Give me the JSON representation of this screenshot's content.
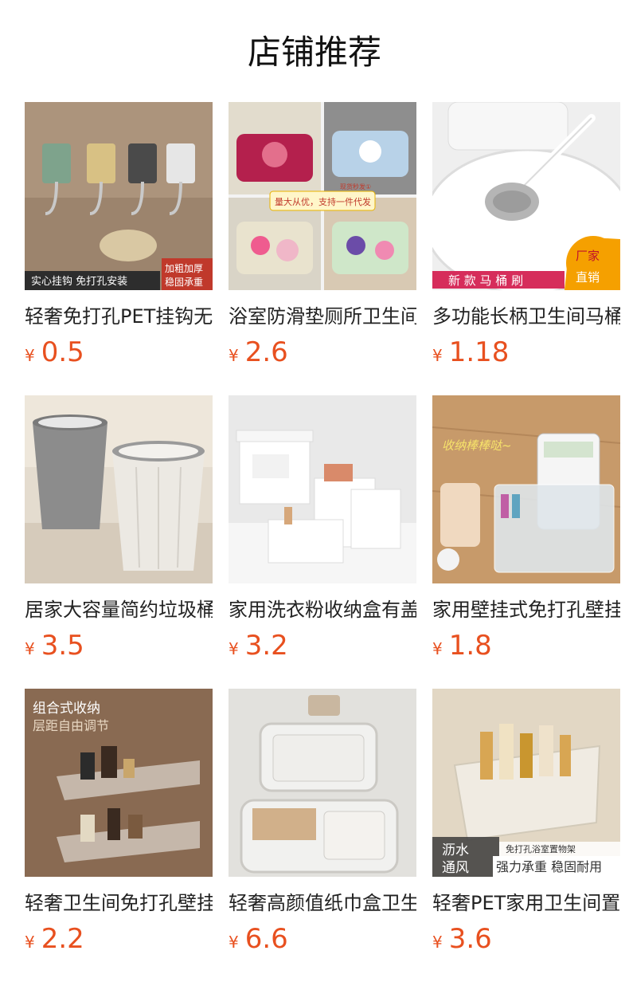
{
  "page": {
    "title": "店铺推荐"
  },
  "products": [
    {
      "name": "轻奢免打孔PET挂钩无痕强力粘胶",
      "currency": "¥",
      "price": "0.5",
      "badges": [
        "实心挂钩 免打孔安装",
        "加粗加厚",
        "稳固承重"
      ]
    },
    {
      "name": "浴室防滑垫厕所卫生间吸水地垫",
      "currency": "¥",
      "price": "2.6",
      "badges": [
        "量大从优，支持一件代发",
        "现货秒发①"
      ]
    },
    {
      "name": "多功能长柄卫生间马桶刷",
      "currency": "¥",
      "price": "1.18",
      "badges": [
        "新 款 马 桶 刷",
        "厂家",
        "直销"
      ]
    },
    {
      "name": "居家大容量简约垃圾桶",
      "currency": "¥",
      "price": "3.5",
      "badges": []
    },
    {
      "name": "家用洗衣粉收纳盒有盖",
      "currency": "¥",
      "price": "3.2",
      "badges": []
    },
    {
      "name": "家用壁挂式免打孔壁挂收纳盒",
      "currency": "¥",
      "price": "1.8",
      "badges": [
        "收纳棒棒哒~"
      ]
    },
    {
      "name": "轻奢卫生间免打孔壁挂置物架",
      "currency": "¥",
      "price": "2.2",
      "badges": [
        "组合式收纳",
        "层距自由调节"
      ]
    },
    {
      "name": "轻奢高颜值纸巾盒卫生间",
      "currency": "¥",
      "price": "6.6",
      "badges": []
    },
    {
      "name": "轻奢PET家用卫生间置物架",
      "currency": "¥",
      "price": "3.6",
      "badges": [
        "沥水",
        "通风",
        "免打孔浴室置物架",
        "强力承重 稳固耐用"
      ]
    }
  ],
  "colors": {
    "price": "#e8501f",
    "title": "#111111",
    "text": "#222222"
  }
}
